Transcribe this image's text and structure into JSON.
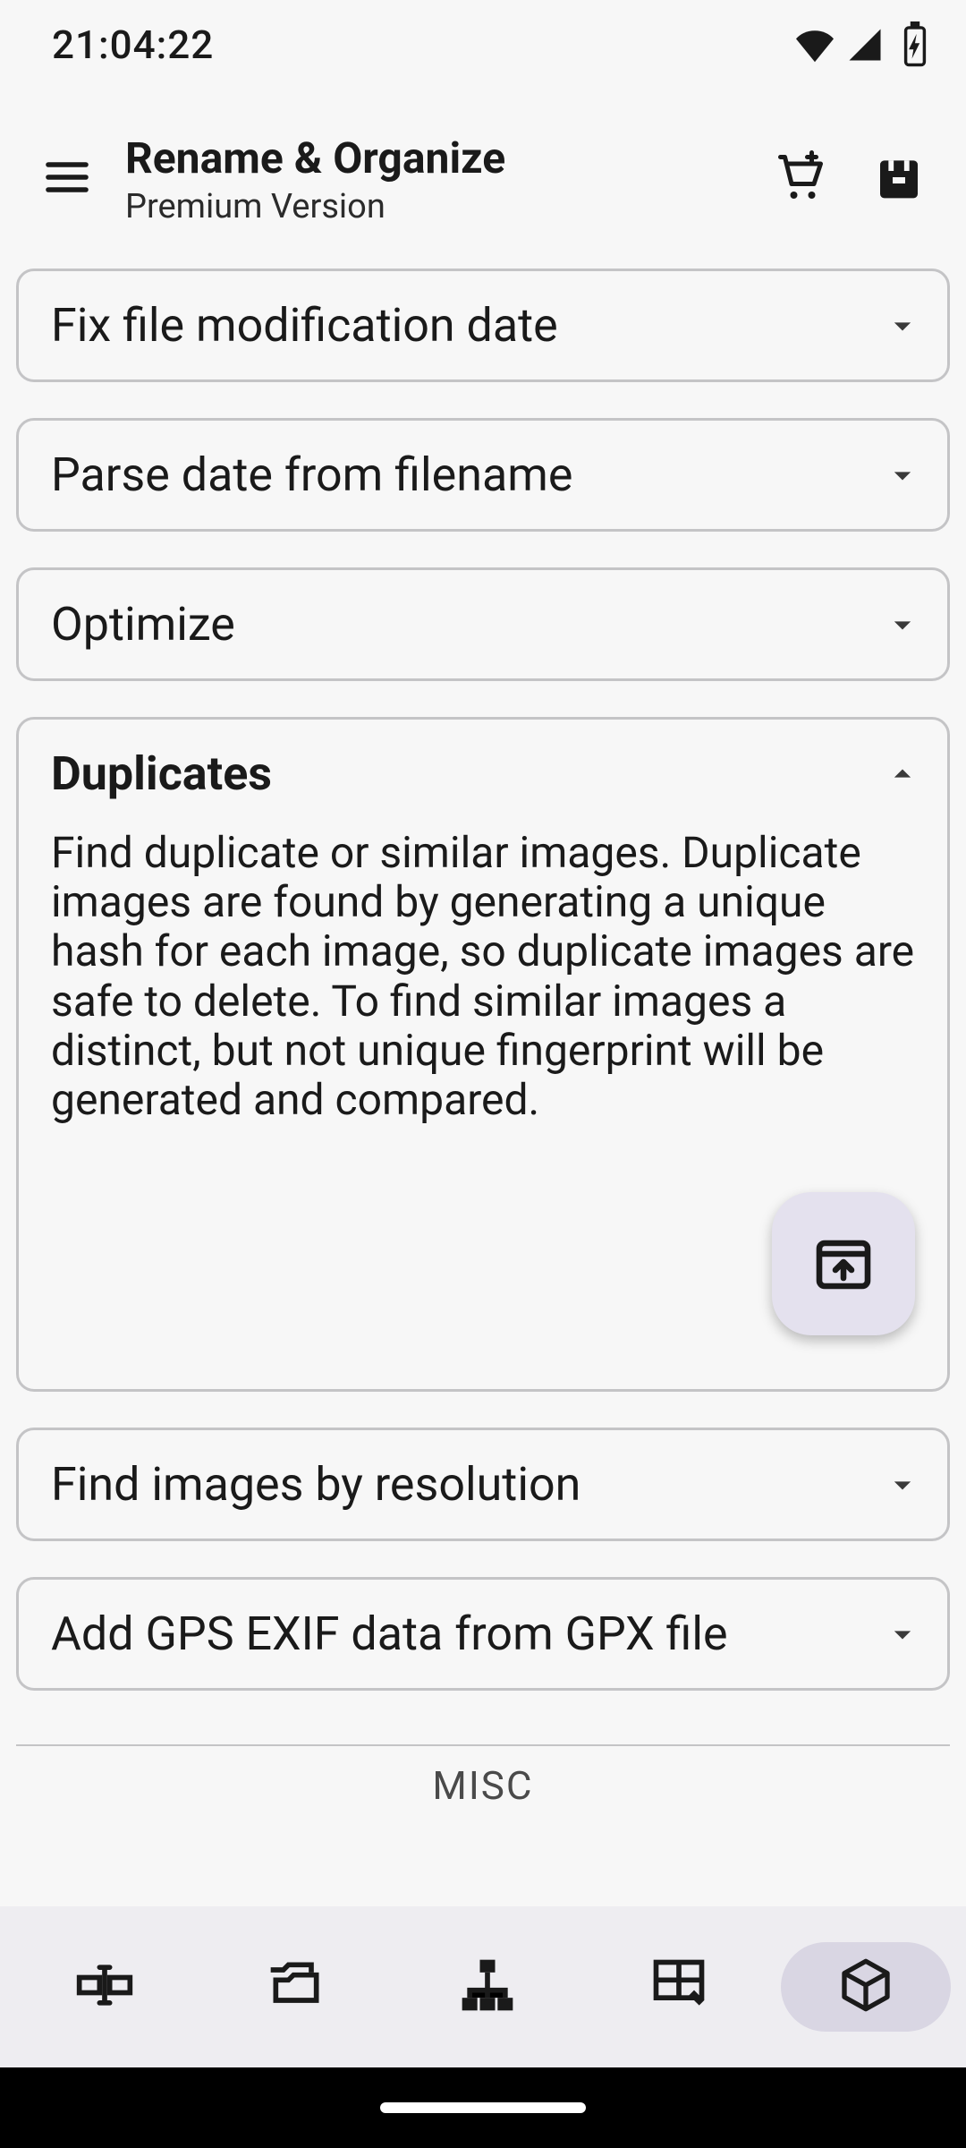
{
  "status": {
    "time": "21:04:22"
  },
  "appbar": {
    "title": "Rename & Organize",
    "subtitle": "Premium Version"
  },
  "cards": {
    "fixdate": {
      "title": "Fix file modification date"
    },
    "parsedate": {
      "title": "Parse date from filename"
    },
    "optimize": {
      "title": "Optimize"
    },
    "duplicates": {
      "title": "Duplicates",
      "body": "Find duplicate or similar images. Duplicate images are found by generating a unique hash for each image, so duplicate images are safe to delete. To find similar images a distinct, but not unique fingerprint will be generated and compared."
    },
    "resolution": {
      "title": "Find images by resolution"
    },
    "gpx": {
      "title": "Add GPS EXIF data from GPX file"
    }
  },
  "section": {
    "misc": "MISC"
  }
}
